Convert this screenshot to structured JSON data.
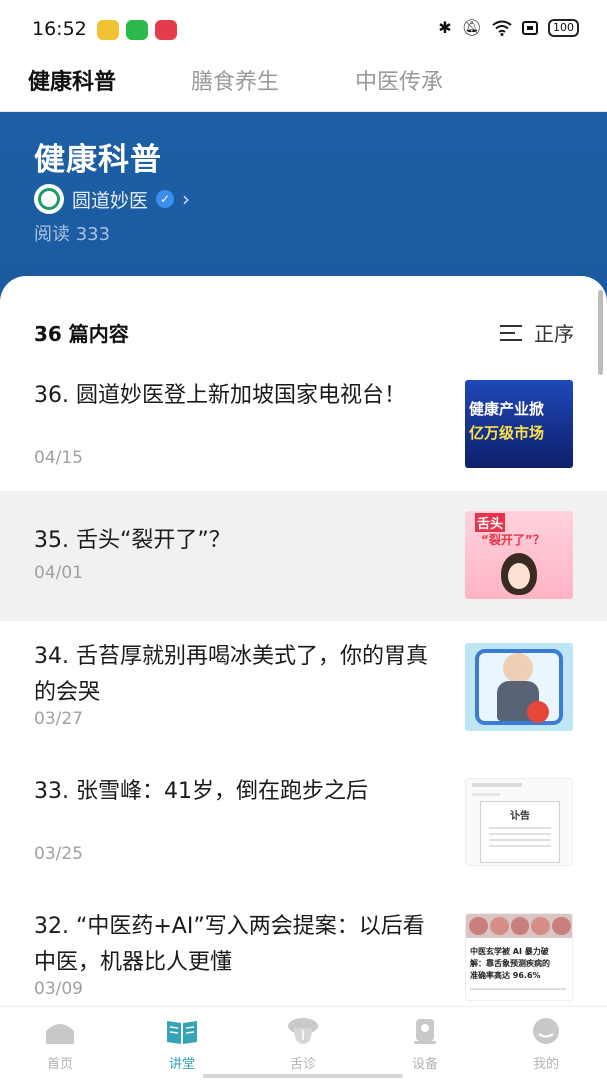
{
  "status_bar": {
    "time": "16:52",
    "battery": "100",
    "icons": [
      "bluetooth-icon",
      "mute-icon",
      "wifi-icon",
      "sim-icon",
      "battery-icon"
    ]
  },
  "top_tabs": [
    {
      "label": "健康科普",
      "active": true
    },
    {
      "label": "膳食养生",
      "active": false
    },
    {
      "label": "中医传承",
      "active": false
    }
  ],
  "hero": {
    "title": "健康科普",
    "author": "圆道妙医",
    "reads": "阅读 333"
  },
  "list": {
    "count_label": "36 篇内容",
    "sort_label": "正序",
    "articles": [
      {
        "title": "36. 圆道妙医登上新加坡国家电视台！",
        "date": "04/15",
        "thumb_text": [
          "健康产业掀",
          "亿万级市场"
        ]
      },
      {
        "title": "35. 舌头“裂开了”？",
        "date": "04/01",
        "thumb_text": [
          "舌头",
          "“裂开了”？"
        ]
      },
      {
        "title": "34. 舌苔厚就别再喝冰美式了，你的胃真的会哭",
        "date": "03/27",
        "thumb_text": []
      },
      {
        "title": "33. 张雪峰：41岁，倒在跑步之后",
        "date": "03/25",
        "thumb_text": [
          "讣告"
        ]
      },
      {
        "title": "32. “中医药+AI”写入两会提案：以后看中医，机器比人更懂",
        "date": "03/09",
        "thumb_text": [
          "中医玄学被 AI 暴力破",
          "解：靠舌象预测疾病的",
          "准确率高达 96.6%"
        ]
      }
    ]
  },
  "bottom_nav": [
    {
      "label": "首页",
      "icon": "home-icon",
      "active": false
    },
    {
      "label": "讲堂",
      "icon": "book-icon",
      "active": true
    },
    {
      "label": "舌诊",
      "icon": "tongue-icon",
      "active": false
    },
    {
      "label": "设备",
      "icon": "device-icon",
      "active": false
    },
    {
      "label": "我的",
      "icon": "profile-icon",
      "active": false
    }
  ],
  "colors": {
    "hero_bg": "#1d5fa6",
    "active_nav": "#36a3b8"
  }
}
